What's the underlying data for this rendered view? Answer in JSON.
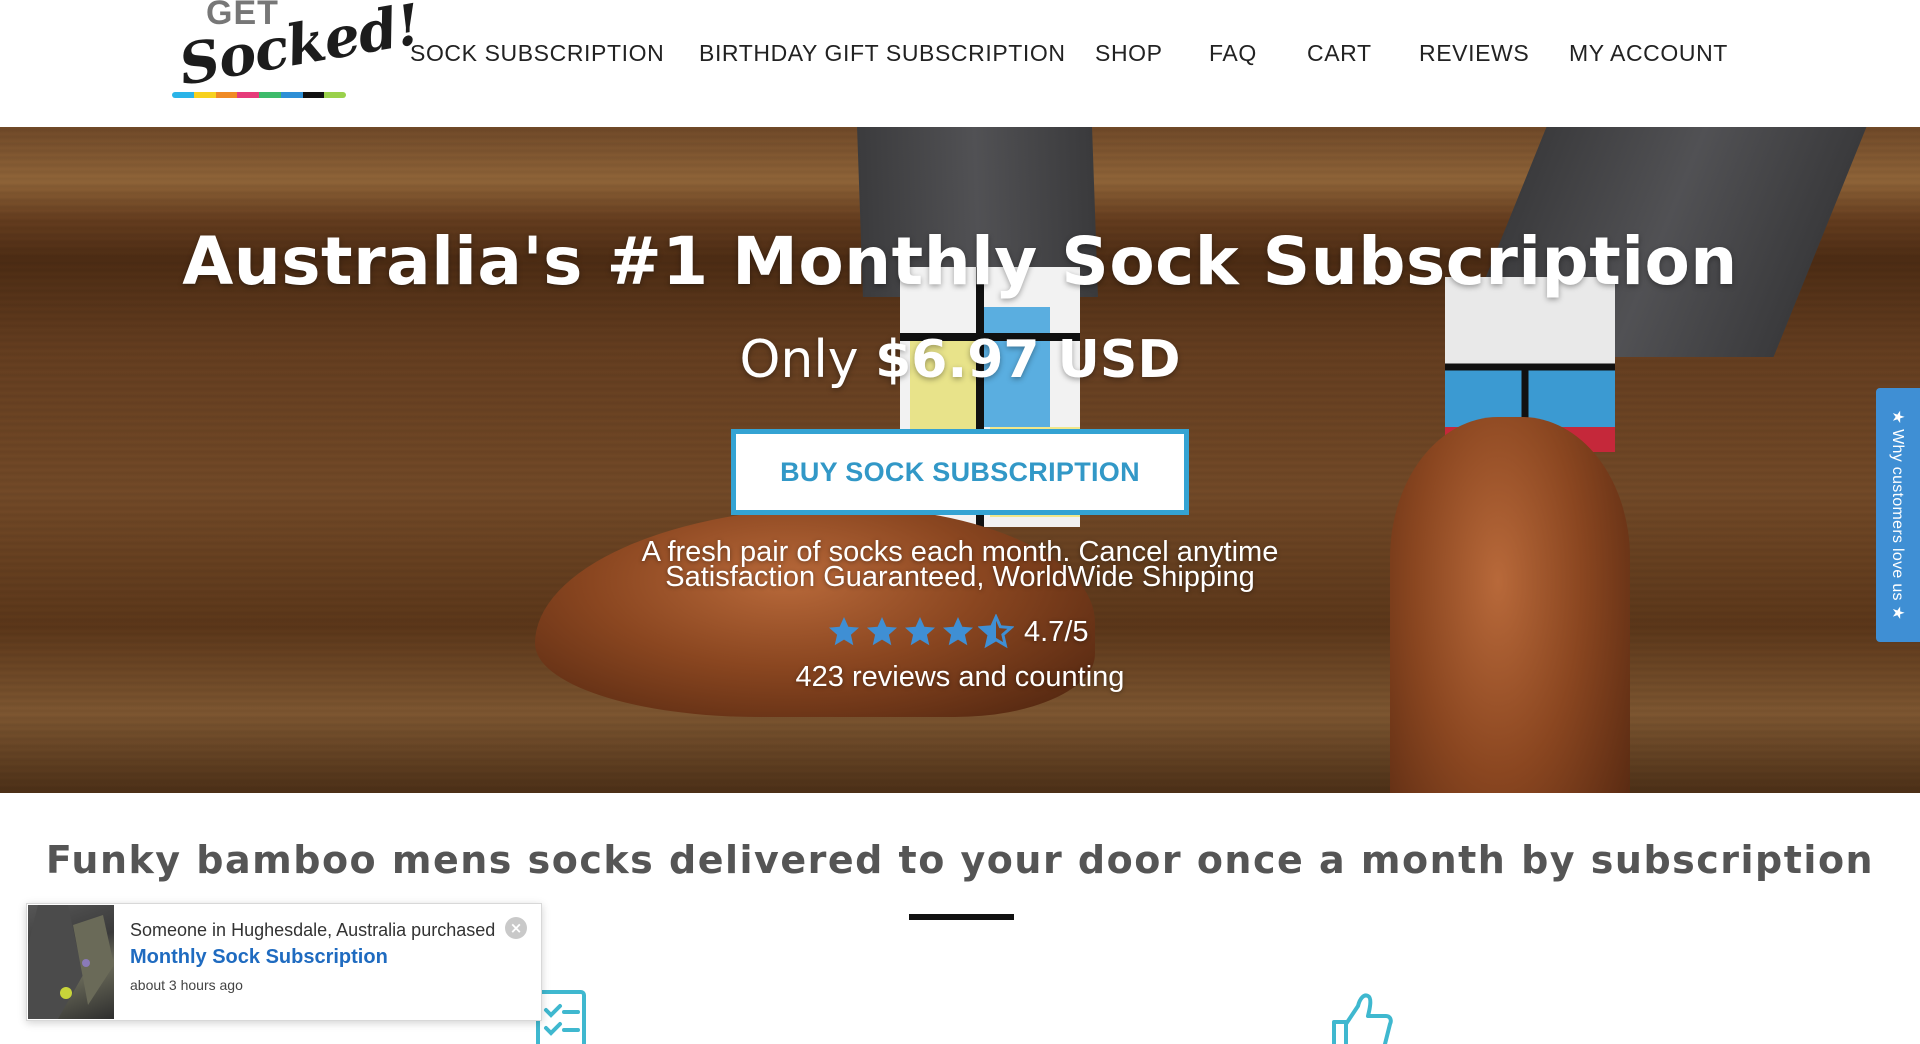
{
  "brand": {
    "logo_top": "GET",
    "logo_main": "Socked!",
    "logo_colors": [
      "#2ab4e8",
      "#f7d11e",
      "#f08a24",
      "#e63b7a",
      "#3dbb6b",
      "#2d8fd6",
      "#111111",
      "#9ad14b"
    ]
  },
  "nav": {
    "items": [
      {
        "label": "SOCK SUBSCRIPTION"
      },
      {
        "label": "BIRTHDAY GIFT SUBSCRIPTION"
      },
      {
        "label": "SHOP"
      },
      {
        "label": "FAQ"
      },
      {
        "label": "CART"
      },
      {
        "label": "REVIEWS"
      },
      {
        "label": "MY ACCOUNT"
      }
    ]
  },
  "hero": {
    "title": "Australia's #1 Monthly Sock Subscription",
    "price_prefix": "Only ",
    "price": "$6.97 USD",
    "cta_label": "BUY SOCK SUBSCRIPTION",
    "tagline_1": "A fresh pair of socks each month. Cancel anytime",
    "tagline_2": "Satisfaction Guaranteed, WorldWide Shipping",
    "rating": 4.7,
    "rating_text": "4.7/5",
    "reviews_count": "423 reviews and counting",
    "star_color": "#3f8fd4"
  },
  "side_tab": {
    "label": "★ Why customers love us ★"
  },
  "section": {
    "title": "Funky bamboo mens socks delivered to your door once a month by subscription"
  },
  "popup": {
    "line1": "Someone in Hughesdale, Australia purchased",
    "product": "Monthly Sock Subscription",
    "time": "about 3 hours ago",
    "close_icon": "×"
  },
  "icons": {
    "checklist": "checklist-icon",
    "thumbs_up": "thumbs-up-icon",
    "accent": "#3fb8cf"
  }
}
